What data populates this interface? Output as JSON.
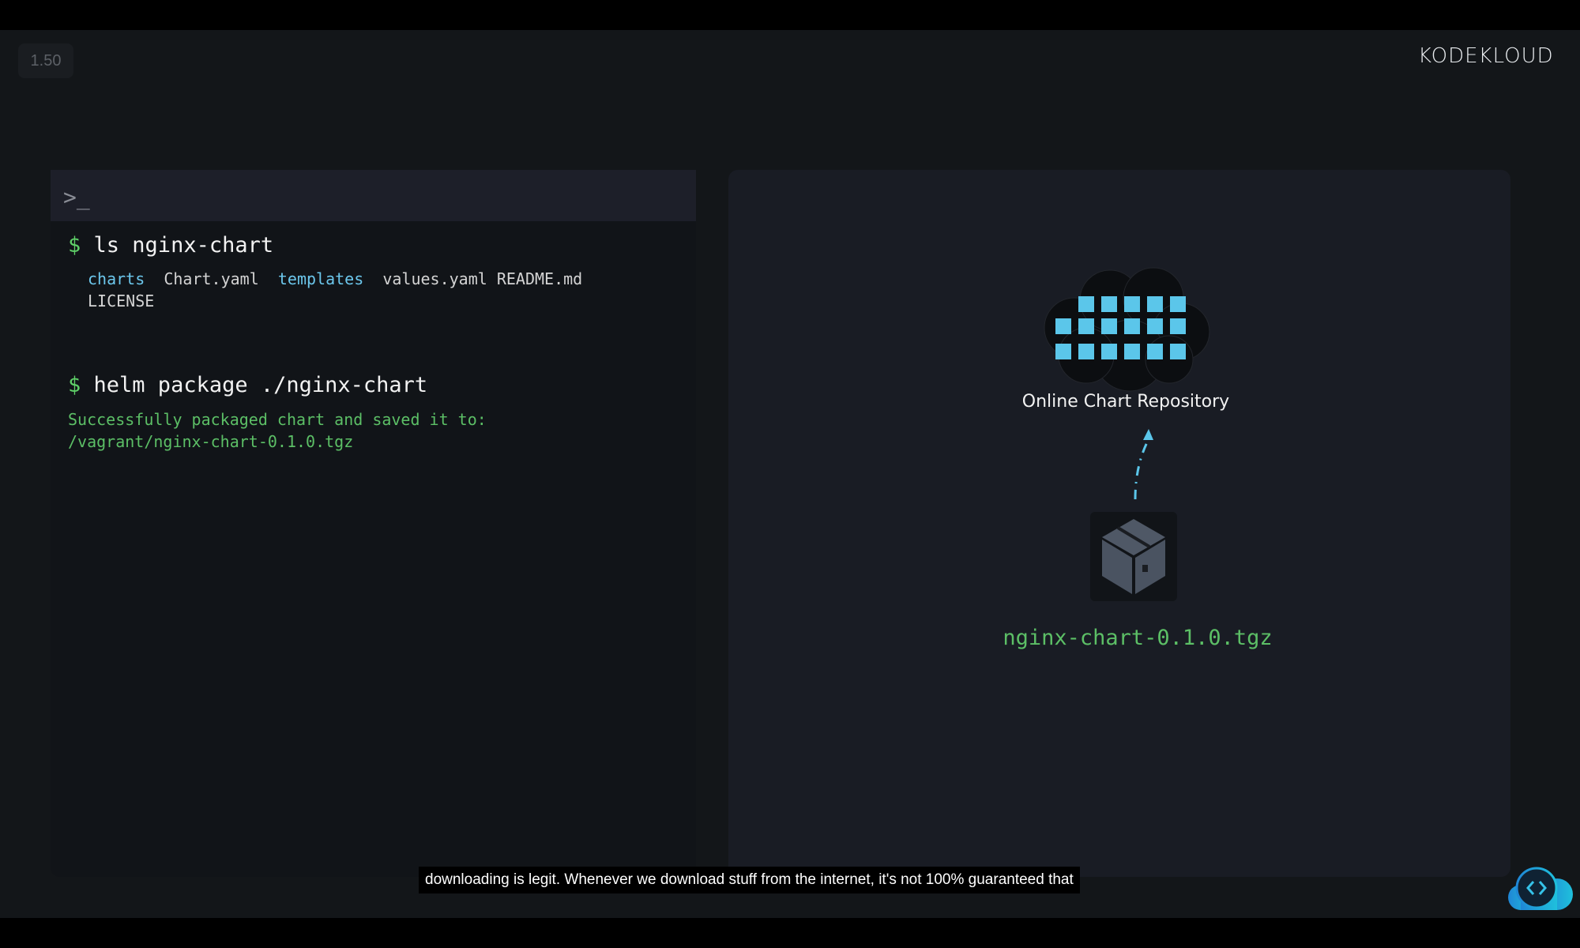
{
  "player": {
    "speed": "1.50",
    "caption": "downloading is legit. Whenever we download stuff from the internet, it's not 100% guaranteed that"
  },
  "brand": {
    "logo": "KODEKLOUD"
  },
  "terminal": {
    "prompt_icon": ">_",
    "commands": [
      {
        "prompt": "$",
        "text": "ls nginx-chart"
      },
      {
        "prompt": "$",
        "text": "helm package ./nginx-chart"
      }
    ],
    "ls_output": {
      "charts": "charts",
      "chart_yaml": "Chart.yaml",
      "templates": "templates",
      "rest": "values.yaml README.md",
      "license": "LICENSE"
    },
    "package_output": [
      "Successfully packaged chart and saved it to:",
      "/vagrant/nginx-chart-0.1.0.tgz"
    ]
  },
  "diagram": {
    "repo_label": "Online Chart Repository",
    "package_label": "nginx-chart-0.1.0.tgz",
    "accent": "#5bc6ea"
  }
}
